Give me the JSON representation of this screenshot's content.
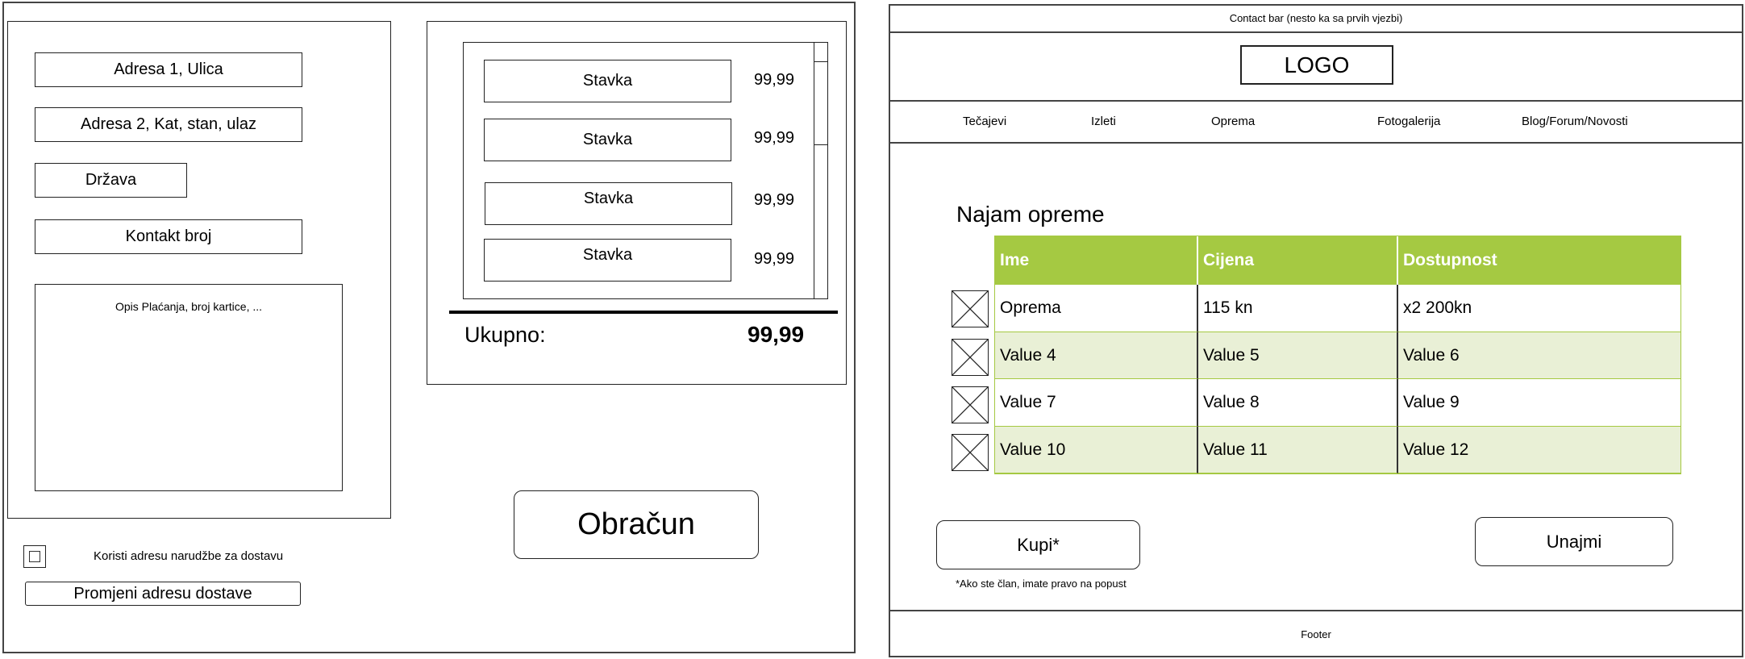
{
  "checkout": {
    "address1": "Adresa 1, Ulica",
    "address2": "Adresa 2, Kat, stan, ulaz",
    "country": "Država",
    "contact": "Kontakt broj",
    "payment_desc": "Opis Plaćanja, broj kartice, ...",
    "use_address_label": "Koristi adresu narudžbe za dostavu",
    "change_address": "Promjeni adresu dostave",
    "cart": {
      "items": [
        {
          "name": "Stavka",
          "price": "99,99"
        },
        {
          "name": "Stavka",
          "price": "99,99"
        },
        {
          "name": "Stavka",
          "price": "99,99"
        },
        {
          "name": "Stavka",
          "price": "99,99"
        }
      ],
      "total_label": "Ukupno:",
      "total_value": "99,99"
    },
    "calculate_button": "Obračun"
  },
  "rental": {
    "contact_bar": "Contact bar (nesto ka sa prvih vjezbi)",
    "logo": "LOGO",
    "nav": [
      "Tečajevi",
      "Izleti",
      "Oprema",
      "Fotogalerija",
      "Blog/Forum/Novosti"
    ],
    "title": "Najam opreme",
    "table": {
      "headers": [
        "Ime",
        "Cijena",
        "Dostupnost"
      ],
      "rows": [
        [
          "Oprema",
          "115 kn",
          "x2 200kn"
        ],
        [
          "Value 4",
          "Value 5",
          "Value 6"
        ],
        [
          "Value 7",
          "Value 8",
          "Value 9"
        ],
        [
          "Value 10",
          "Value 11",
          "Value 12"
        ]
      ]
    },
    "buy_button": "Kupi*",
    "rent_button": "Unajmi",
    "member_note": "*Ako ste član, imate pravo na popust",
    "footer": "Footer"
  }
}
